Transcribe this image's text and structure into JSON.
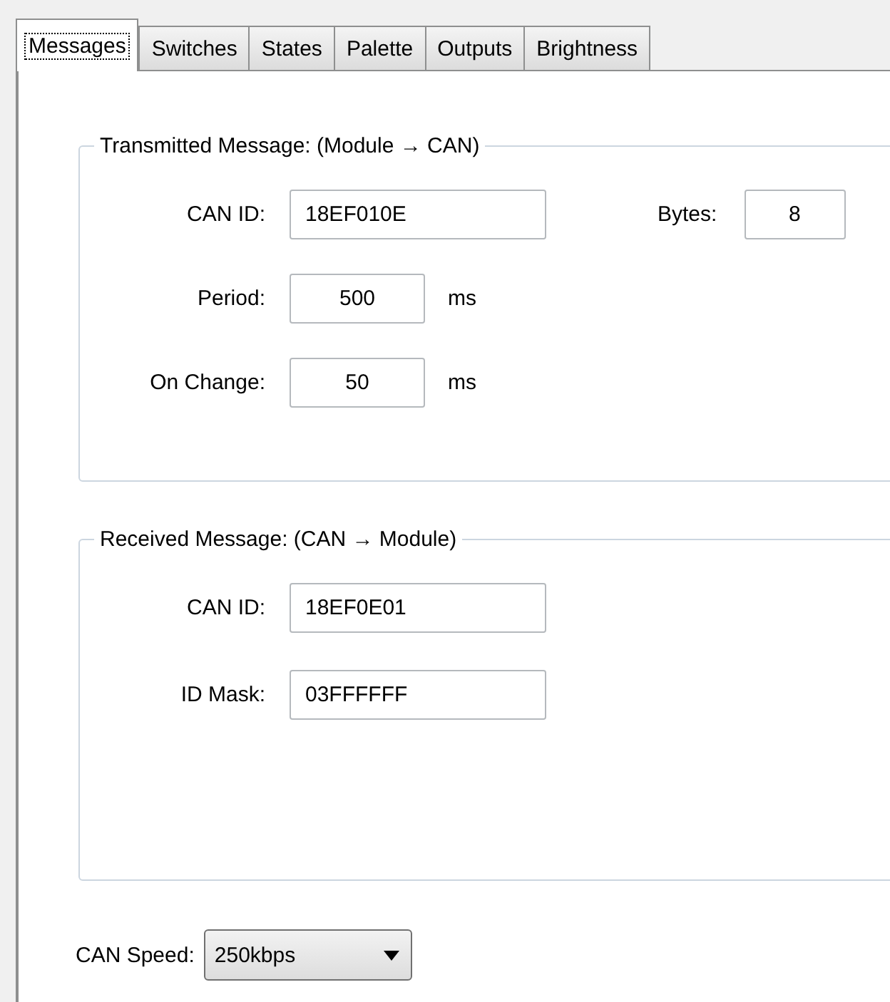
{
  "tabs": [
    {
      "label": "Messages",
      "selected": true
    },
    {
      "label": "Switches",
      "selected": false
    },
    {
      "label": "States",
      "selected": false
    },
    {
      "label": "Palette",
      "selected": false
    },
    {
      "label": "Outputs",
      "selected": false
    },
    {
      "label": "Brightness",
      "selected": false
    }
  ],
  "groups": [
    {
      "title": "Transmitted Message:  (Module → CAN)",
      "rows": [
        [
          {
            "label": "CAN ID:",
            "value": "18EF010E",
            "kind": "text"
          },
          {
            "label": "Bytes:",
            "value": "8",
            "kind": "small"
          }
        ],
        [
          {
            "label": "Period:",
            "value": "500",
            "kind": "number",
            "unit": "ms"
          }
        ],
        [
          {
            "label": "On Change:",
            "value": "50",
            "kind": "number",
            "unit": "ms"
          }
        ]
      ]
    },
    {
      "title": "Received Message:  (CAN → Module)",
      "rows": [
        [
          {
            "label": "CAN ID:",
            "value": "18EF0E01",
            "kind": "text"
          }
        ],
        [
          {
            "label": "ID Mask:",
            "value": "03FFFFFF",
            "kind": "text"
          }
        ]
      ]
    }
  ],
  "can_speed": {
    "label": "CAN Speed:",
    "value": "250kbps"
  }
}
